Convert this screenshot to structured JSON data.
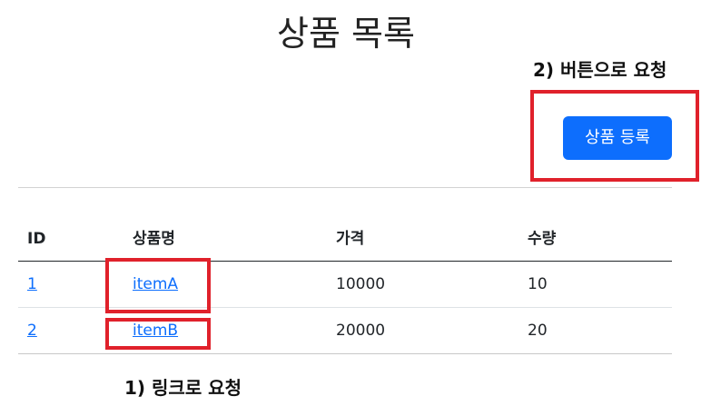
{
  "page": {
    "title": "상품 목록"
  },
  "annotations": {
    "button_request": "2) 버튼으로 요청",
    "link_request": "1) 링크로 요청"
  },
  "toolbar": {
    "add_product_label": "상품 등록"
  },
  "colors": {
    "primary": "#0d6efd",
    "annotation_box": "#e0212b"
  },
  "table": {
    "headers": [
      "ID",
      "상품명",
      "가격",
      "수량"
    ],
    "rows": [
      {
        "id": "1",
        "name": "itemA",
        "price": "10000",
        "quantity": "10"
      },
      {
        "id": "2",
        "name": "itemB",
        "price": "20000",
        "quantity": "20"
      }
    ]
  }
}
